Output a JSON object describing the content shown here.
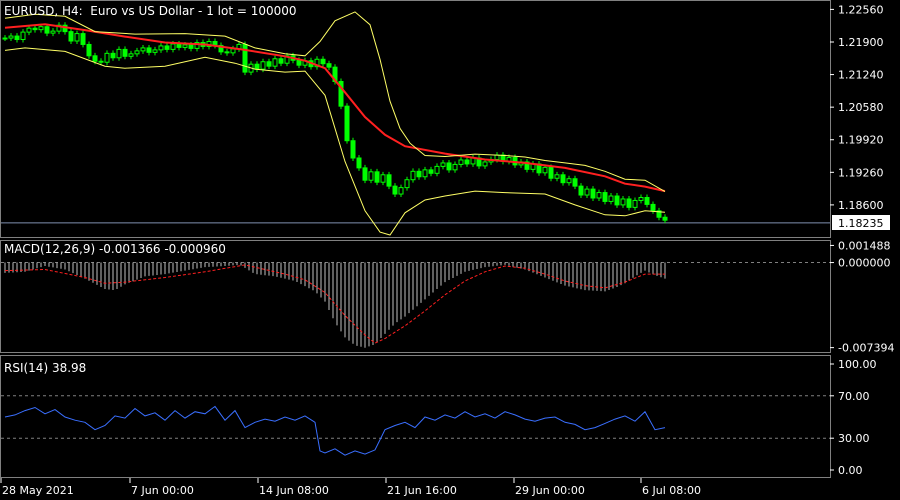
{
  "chart_title": "EURUSD, H4:  Euro vs US Dollar - 1 lot = 100000",
  "last_price": "1.18235",
  "time_labels": [
    "28 May 2021",
    "7 Jun 00:00",
    "14 Jun 08:00",
    "21 Jun 16:00",
    "29 Jun 00:00",
    "6 Jul 08:00"
  ],
  "colors": {
    "background": "#000000",
    "candles": "#00ff00",
    "bollinger": "#ffff66",
    "moving_average": "#ff2020",
    "price_line": "#8090b0",
    "macd_histogram": "#c0c0c0",
    "macd_signal": "#ff2020",
    "rsi": "#3a6fff",
    "grid": "#808080"
  },
  "chart_data": [
    {
      "type": "line",
      "panel": "price",
      "title": "EURUSD, H4:  Euro vs US Dollar - 1 lot = 100000",
      "y_ticks": [
        "1.22560",
        "1.21900",
        "1.21240",
        "1.20580",
        "1.19920",
        "1.19260",
        "1.18600"
      ],
      "ylim": [
        1.1797,
        1.2271
      ],
      "current_price": 1.18235,
      "series": [
        {
          "kind": "close",
          "x": [
            0,
            6,
            12,
            18,
            24,
            30,
            36,
            42,
            48,
            54,
            60,
            66,
            72,
            78,
            84,
            90,
            96,
            102,
            108,
            114,
            120,
            126,
            132,
            138,
            144,
            150,
            156,
            162,
            168,
            174,
            180,
            186,
            192,
            198,
            204,
            210,
            216,
            222,
            228,
            234,
            240,
            246,
            252,
            258,
            264,
            270,
            276,
            282,
            288,
            294,
            300,
            306,
            312,
            318,
            324,
            330,
            336,
            342,
            348,
            354,
            360,
            366,
            372,
            378,
            384,
            390,
            396,
            402,
            408,
            414,
            420,
            426,
            432,
            438,
            444,
            450,
            456,
            462,
            468,
            474,
            480,
            486,
            492,
            498,
            504,
            510,
            516,
            522,
            528,
            534,
            540,
            546,
            552,
            558,
            564,
            570,
            576,
            582,
            588,
            594,
            600,
            606,
            612,
            618,
            624,
            630,
            636,
            642,
            648,
            654,
            660
          ],
          "values": [
            1.2198,
            1.2202,
            1.2195,
            1.221,
            1.2218,
            1.2215,
            1.2221,
            1.2208,
            1.2212,
            1.2224,
            1.2211,
            1.2192,
            1.2207,
            1.2185,
            1.2162,
            1.2151,
            1.2149,
            1.2167,
            1.2158,
            1.2175,
            1.2161,
            1.2166,
            1.2172,
            1.2178,
            1.2169,
            1.2174,
            1.2182,
            1.2175,
            1.2186,
            1.2179,
            1.2184,
            1.2177,
            1.2189,
            1.2181,
            1.2191,
            1.2183,
            1.217,
            1.2168,
            1.2176,
            1.2185,
            1.2129,
            1.2145,
            1.2135,
            1.215,
            1.2141,
            1.2156,
            1.2147,
            1.2162,
            1.2153,
            1.2143,
            1.2152,
            1.214,
            1.2155,
            1.2146,
            1.2139,
            1.211,
            1.206,
            1.199,
            1.1955,
            1.1935,
            1.191,
            1.1927,
            1.1906,
            1.1921,
            1.1898,
            1.1882,
            1.1895,
            1.1911,
            1.1928,
            1.1917,
            1.1931,
            1.1924,
            1.1938,
            1.1945,
            1.1931,
            1.1942,
            1.1951,
            1.1943,
            1.1955,
            1.1939,
            1.1947,
            1.1952,
            1.1961,
            1.1948,
            1.1956,
            1.1941,
            1.1947,
            1.1932,
            1.1943,
            1.1925,
            1.1936,
            1.1914,
            1.1921,
            1.1905,
            1.1913,
            1.1898,
            1.188,
            1.1892,
            1.1874,
            1.1885,
            1.1867,
            1.1878,
            1.186,
            1.1872,
            1.1855,
            1.1869,
            1.1875,
            1.1861,
            1.1848,
            1.1835,
            1.1829
          ]
        },
        {
          "kind": "moving_average",
          "x": [
            0,
            40,
            80,
            120,
            160,
            200,
            240,
            280,
            300,
            320,
            340,
            360,
            380,
            400,
            440,
            480,
            520,
            560,
            600,
            620,
            640,
            660
          ],
          "values": [
            1.2219,
            1.2226,
            1.2214,
            1.2201,
            1.2189,
            1.2185,
            1.2174,
            1.2161,
            1.2152,
            1.2137,
            1.2088,
            1.2038,
            1.2002,
            1.1979,
            1.1964,
            1.1952,
            1.1945,
            1.1935,
            1.1918,
            1.1903,
            1.1897,
            1.1888
          ]
        },
        {
          "kind": "bollinger_upper",
          "x": [
            0,
            30,
            60,
            90,
            130,
            180,
            220,
            250,
            280,
            300,
            315,
            330,
            350,
            365,
            375,
            385,
            395,
            405,
            420,
            440,
            470,
            500,
            520,
            540,
            560,
            580,
            600,
            620,
            640,
            660
          ],
          "values": [
            1.2238,
            1.2246,
            1.2242,
            1.2211,
            1.2206,
            1.2207,
            1.2202,
            1.2178,
            1.2166,
            1.2162,
            1.2191,
            1.2233,
            1.2251,
            1.2225,
            1.2155,
            1.207,
            1.2015,
            1.1985,
            1.196,
            1.1958,
            1.1963,
            1.196,
            1.1957,
            1.195,
            1.1945,
            1.194,
            1.1928,
            1.1912,
            1.191,
            1.1887
          ]
        },
        {
          "kind": "bollinger_lower",
          "x": [
            0,
            20,
            60,
            100,
            120,
            160,
            200,
            230,
            250,
            280,
            300,
            320,
            340,
            360,
            375,
            385,
            400,
            420,
            440,
            470,
            500,
            540,
            570,
            600,
            620,
            640,
            660
          ],
          "values": [
            1.2173,
            1.2178,
            1.2171,
            1.2141,
            1.2137,
            1.2141,
            1.2159,
            1.2147,
            1.2135,
            1.2129,
            1.2131,
            1.2082,
            1.1948,
            1.1848,
            1.1805,
            1.1799,
            1.1844,
            1.187,
            1.1878,
            1.1888,
            1.1885,
            1.1882,
            1.186,
            1.184,
            1.1838,
            1.1848,
            1.1845
          ]
        }
      ]
    },
    {
      "type": "bar",
      "panel": "macd",
      "label": "MACD(12,26,9) -0.001366 -0.000960",
      "y_ticks": [
        "0.001488",
        "0.000000",
        "-0.007394"
      ],
      "ylim": [
        -0.0076,
        0.0017
      ],
      "histogram": {
        "x": [
          0,
          20,
          40,
          60,
          80,
          100,
          110,
          120,
          140,
          160,
          180,
          200,
          220,
          235,
          250,
          270,
          290,
          310,
          320,
          330,
          340,
          350,
          360,
          370,
          380,
          390,
          400,
          420,
          440,
          460,
          480,
          500,
          520,
          540,
          560,
          580,
          600,
          610,
          620,
          630,
          640,
          650,
          660
        ],
        "values": [
          -0.0009,
          -0.0008,
          -0.0003,
          -0.0006,
          -0.0014,
          -0.0023,
          -0.0024,
          -0.0019,
          -0.0012,
          -0.001,
          -0.0007,
          -0.0004,
          -0.0003,
          -0.0002,
          -0.001,
          -0.0012,
          -0.0016,
          -0.0025,
          -0.0034,
          -0.0052,
          -0.0065,
          -0.0072,
          -0.0074,
          -0.0071,
          -0.0062,
          -0.0053,
          -0.0047,
          -0.0032,
          -0.0017,
          -0.0008,
          -0.0004,
          -0.0002,
          -0.0006,
          -0.0013,
          -0.002,
          -0.0024,
          -0.0025,
          -0.0022,
          -0.0018,
          -0.0012,
          -0.0007,
          -0.0011,
          -0.0014
        ]
      },
      "signal": {
        "x": [
          0,
          40,
          80,
          100,
          120,
          160,
          200,
          240,
          260,
          280,
          300,
          320,
          340,
          360,
          370,
          380,
          400,
          420,
          440,
          460,
          480,
          500,
          520,
          540,
          560,
          580,
          600,
          620,
          640,
          660
        ],
        "values": [
          -0.0007,
          -0.0006,
          -0.0013,
          -0.0018,
          -0.0017,
          -0.0013,
          -0.0008,
          -0.0002,
          -0.0006,
          -0.001,
          -0.0015,
          -0.0026,
          -0.0046,
          -0.0063,
          -0.007,
          -0.0066,
          -0.0055,
          -0.0042,
          -0.0028,
          -0.0016,
          -0.0008,
          -0.0003,
          -0.0005,
          -0.001,
          -0.0016,
          -0.002,
          -0.0022,
          -0.0017,
          -0.001,
          -0.001
        ]
      }
    },
    {
      "type": "line",
      "panel": "rsi",
      "label": "RSI(14) 38.98",
      "y_ticks": [
        "100.00",
        "70.00",
        "30.00",
        "0.00"
      ],
      "ylim": [
        0,
        100
      ],
      "levels": [
        70,
        30
      ],
      "series": [
        {
          "name": "RSI(14)",
          "x": [
            0,
            10,
            20,
            30,
            40,
            50,
            60,
            70,
            80,
            90,
            100,
            110,
            120,
            130,
            140,
            150,
            160,
            170,
            180,
            190,
            200,
            210,
            220,
            230,
            240,
            250,
            260,
            270,
            280,
            290,
            300,
            310,
            315,
            320,
            330,
            340,
            350,
            360,
            370,
            380,
            390,
            400,
            410,
            420,
            430,
            440,
            450,
            460,
            470,
            480,
            490,
            500,
            510,
            520,
            530,
            540,
            550,
            560,
            570,
            580,
            590,
            600,
            610,
            620,
            630,
            640,
            650,
            660
          ],
          "values": [
            50,
            52,
            56,
            59,
            53,
            57,
            50,
            47,
            45,
            38,
            42,
            51,
            49,
            58,
            51,
            54,
            47,
            56,
            49,
            55,
            53,
            60,
            47,
            56,
            40,
            45,
            48,
            46,
            50,
            47,
            51,
            45,
            18,
            16,
            20,
            14,
            18,
            15,
            19,
            38,
            42,
            45,
            40,
            50,
            47,
            52,
            49,
            55,
            50,
            53,
            49,
            55,
            52,
            48,
            46,
            49,
            50,
            45,
            43,
            38,
            40,
            44,
            48,
            51,
            46,
            55,
            38,
            40
          ]
        }
      ]
    }
  ]
}
